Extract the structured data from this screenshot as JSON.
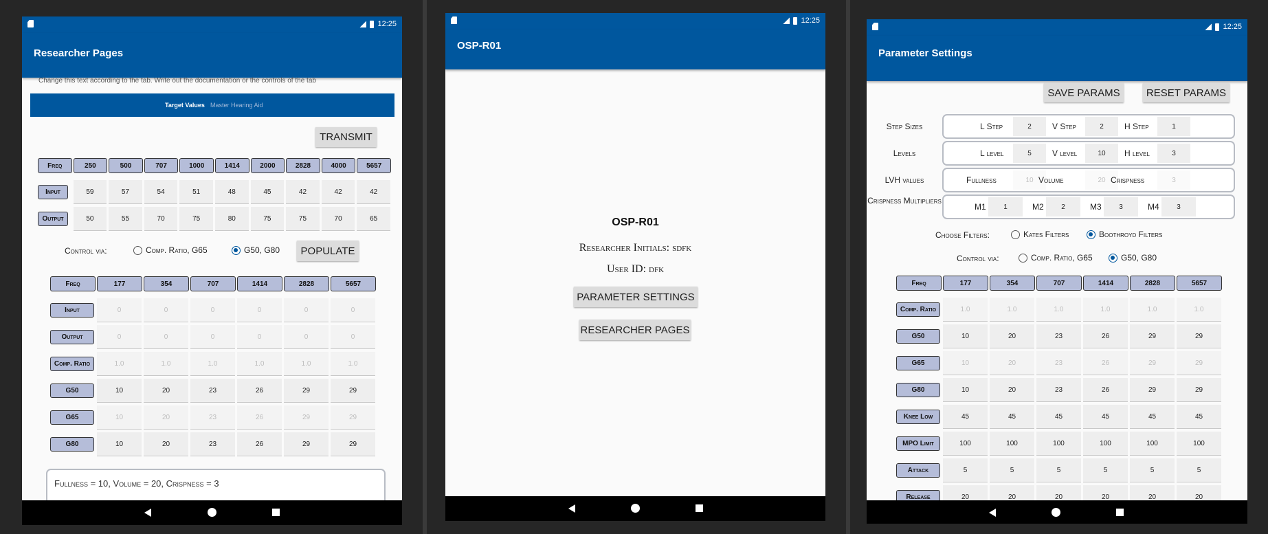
{
  "status": {
    "time": "12:25"
  },
  "left": {
    "title": "Researcher Pages",
    "description": "Change this text according to the tab. Write out the documentation or the controls of the tab",
    "tabs": [
      "Target Values",
      "Master Hearing Aid"
    ],
    "transmit": "TRANSMIT",
    "table1": {
      "headers": [
        "Freq",
        "250",
        "500",
        "707",
        "1000",
        "1414",
        "2000",
        "2828",
        "4000",
        "5657"
      ],
      "rows": [
        {
          "label": "Input",
          "values": [
            "59",
            "57",
            "54",
            "51",
            "48",
            "45",
            "42",
            "42",
            "42"
          ]
        },
        {
          "label": "Output",
          "values": [
            "50",
            "55",
            "70",
            "75",
            "80",
            "75",
            "75",
            "70",
            "65"
          ]
        }
      ]
    },
    "control_via": "Control via:",
    "radio1": "Comp. Ratio, G65",
    "radio2": "G50, G80",
    "populate": "POPULATE",
    "table2": {
      "headers": [
        "Freq",
        "177",
        "354",
        "707",
        "1414",
        "2828",
        "5657"
      ],
      "rows": [
        {
          "label": "Input",
          "values": [
            "0",
            "0",
            "0",
            "0",
            "0",
            "0"
          ],
          "dim": true
        },
        {
          "label": "Output",
          "values": [
            "0",
            "0",
            "0",
            "0",
            "0",
            "0"
          ],
          "dim": true
        },
        {
          "label": "Comp. Ratio",
          "values": [
            "1.0",
            "1.0",
            "1.0",
            "1.0",
            "1.0",
            "1.0"
          ],
          "dim": true
        },
        {
          "label": "G50",
          "values": [
            "10",
            "20",
            "23",
            "26",
            "29",
            "29"
          ],
          "dim": false
        },
        {
          "label": "G65",
          "values": [
            "10",
            "20",
            "23",
            "26",
            "29",
            "29"
          ],
          "dim": true
        },
        {
          "label": "G80",
          "values": [
            "10",
            "20",
            "23",
            "26",
            "29",
            "29"
          ],
          "dim": false
        }
      ]
    },
    "summary": "Fullness = 10, Volume = 20, Crispness = 3"
  },
  "middle": {
    "title": "OSP-R01",
    "heading": "OSP-R01",
    "initials": "Researcher Initials: sdfk",
    "user": "User ID: dfk",
    "btn_params": "PARAMETER SETTINGS",
    "btn_pages": "RESEARCHER PAGES"
  },
  "right": {
    "title": "Parameter Settings",
    "save": "SAVE PARAMS",
    "reset": "RESET PARAMS",
    "rows": [
      {
        "label": "Step Sizes",
        "items": [
          [
            "L Step",
            "2"
          ],
          [
            "V Step",
            "2"
          ],
          [
            "H Step",
            "1"
          ]
        ]
      },
      {
        "label": "Levels",
        "items": [
          [
            "L level",
            "5"
          ],
          [
            "V level",
            "10"
          ],
          [
            "H level",
            "3"
          ]
        ]
      },
      {
        "label": "LVH values",
        "items": [
          [
            "Fullness",
            "10"
          ],
          [
            "Volume",
            "20"
          ],
          [
            "Crispness",
            "3"
          ]
        ]
      },
      {
        "label": "Crispness Multipliers",
        "items": [
          [
            "M1",
            "1"
          ],
          [
            "M2",
            "2"
          ],
          [
            "M3",
            "3"
          ],
          [
            "M4",
            "3"
          ]
        ]
      }
    ],
    "choose_filters": "Choose Filters:",
    "filter1": "Kates Filters",
    "filter2": "Boothroyd Filters",
    "control_via": "Control via:",
    "radio1": "Comp. Ratio, G65",
    "radio2": "G50, G80",
    "table": {
      "headers": [
        "Freq",
        "177",
        "354",
        "707",
        "1414",
        "2828",
        "5657"
      ],
      "rows": [
        {
          "label": "Comp. Ratio",
          "values": [
            "1.0",
            "1.0",
            "1.0",
            "1.0",
            "1.0",
            "1.0"
          ],
          "dim": true
        },
        {
          "label": "G50",
          "values": [
            "10",
            "20",
            "23",
            "26",
            "29",
            "29"
          ],
          "dim": false
        },
        {
          "label": "G65",
          "values": [
            "10",
            "20",
            "23",
            "26",
            "29",
            "29"
          ],
          "dim": true
        },
        {
          "label": "G80",
          "values": [
            "10",
            "20",
            "23",
            "26",
            "29",
            "29"
          ],
          "dim": false
        },
        {
          "label": "Knee Low",
          "values": [
            "45",
            "45",
            "45",
            "45",
            "45",
            "45"
          ],
          "dim": false
        },
        {
          "label": "MPO Limit",
          "values": [
            "100",
            "100",
            "100",
            "100",
            "100",
            "100"
          ],
          "dim": false
        },
        {
          "label": "Attack",
          "values": [
            "5",
            "5",
            "5",
            "5",
            "5",
            "5"
          ],
          "dim": false
        },
        {
          "label": "Release",
          "values": [
            "20",
            "20",
            "20",
            "20",
            "20",
            "20"
          ],
          "dim": false
        }
      ]
    }
  }
}
